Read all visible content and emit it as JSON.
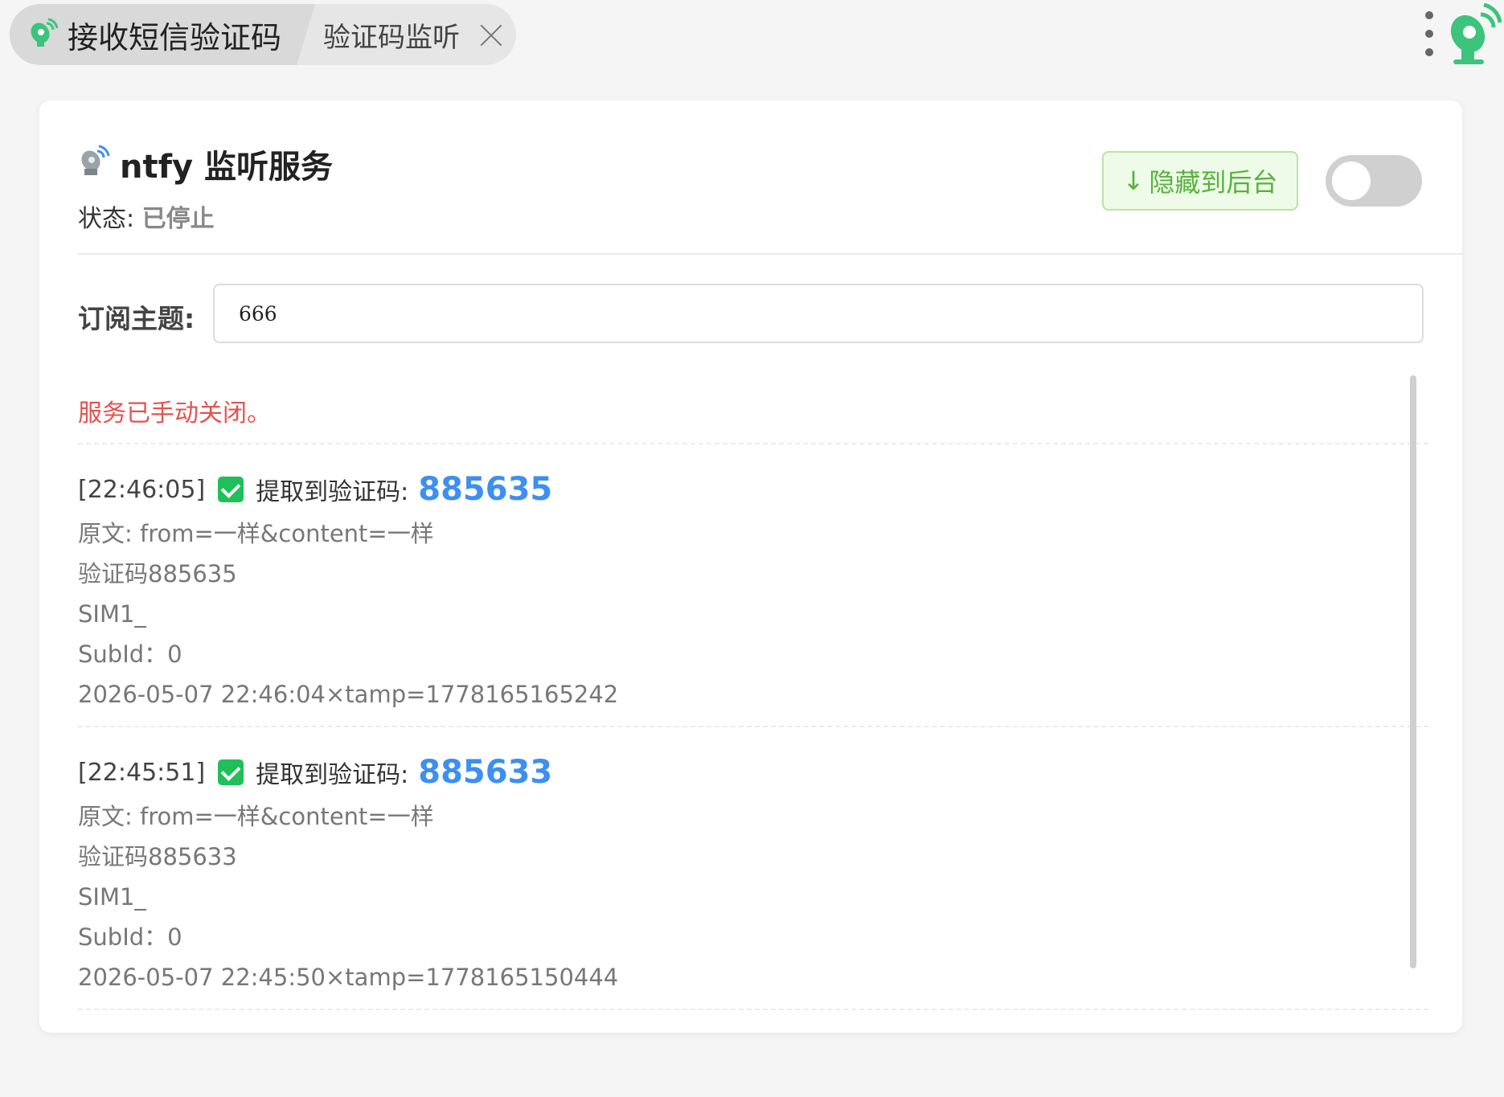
{
  "tabs": {
    "active_title": "接收短信验证码",
    "second_title": "验证码监听"
  },
  "service": {
    "title": "ntfy 监听服务",
    "status_label": "状态:",
    "status_value": "已停止",
    "hide_button": "隐藏到后台",
    "hide_arrow": "↓",
    "toggle_on": false
  },
  "topic": {
    "label": "订阅主题:",
    "value": "666"
  },
  "log": {
    "system_message": "服务已手动关闭。",
    "entries": [
      {
        "time": "[22:46:05]",
        "label": "提取到验证码:",
        "code": "885635",
        "lines": [
          "原文: from=一样&content=一样",
          "验证码885635",
          "SIM1_",
          "SubId：0",
          "2026-05-07 22:46:04×tamp=1778165165242"
        ]
      },
      {
        "time": "[22:45:51]",
        "label": "提取到验证码:",
        "code": "885633",
        "lines": [
          "原文: from=一样&content=一样",
          "验证码885633",
          "SIM1_",
          "SubId：0",
          "2026-05-07 22:45:50×tamp=1778165150444"
        ]
      }
    ]
  },
  "colors": {
    "accent_green": "#57b33b",
    "code_blue": "#3d8ff0",
    "error_red": "#e4524f",
    "check_green": "#1fc05a"
  },
  "icons": {
    "tab_icon": "satellite-dish-icon",
    "service_icon": "satellite-dish-icon",
    "menu": "more-vertical-icon"
  }
}
